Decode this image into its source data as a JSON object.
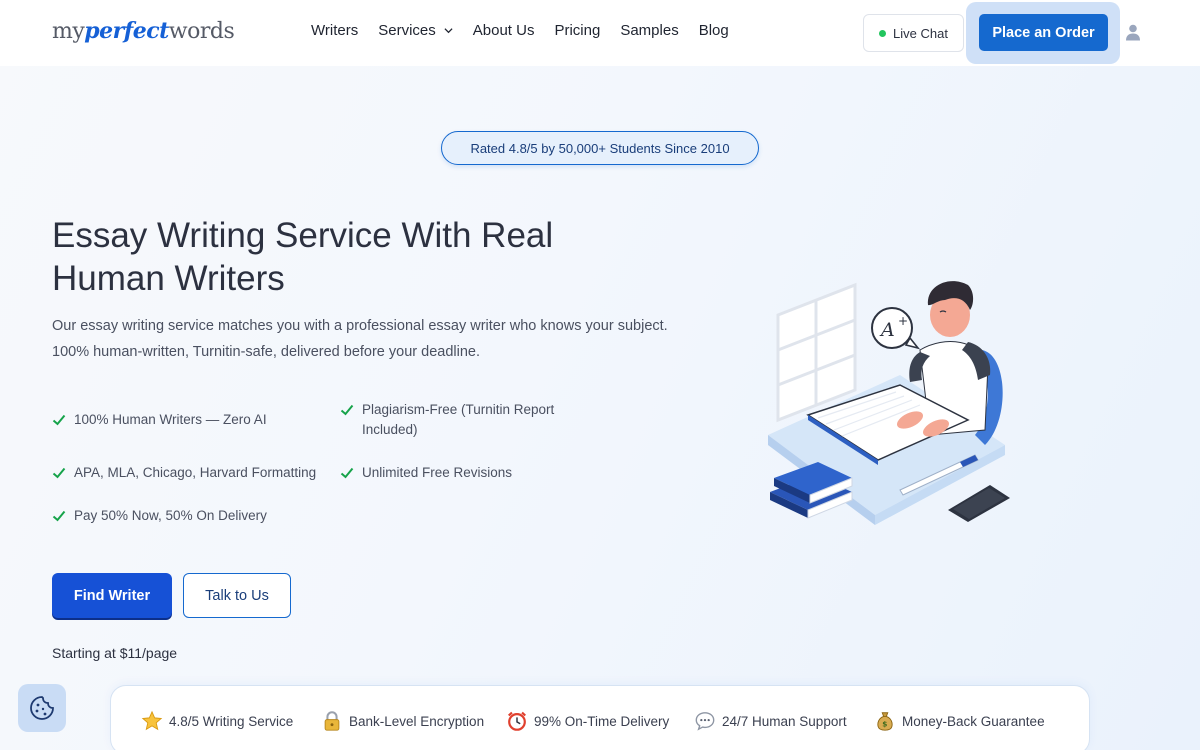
{
  "header": {
    "logo": {
      "part1": "my",
      "part2": "perfect",
      "part3": "words"
    },
    "nav": [
      {
        "label": "Writers"
      },
      {
        "label": "Services"
      },
      {
        "label": "About Us"
      },
      {
        "label": "Pricing"
      },
      {
        "label": "Samples"
      },
      {
        "label": "Blog"
      }
    ],
    "live_chat": "Live Chat",
    "place_order": "Place an Order"
  },
  "hero": {
    "rating_pill": "Rated 4.8/5 by 50,000+ Students Since 2010",
    "title": "Essay Writing Service With Real Human Writers",
    "description": "Our essay writing service matches you with a professional essay writer who knows your subject. 100% human-written, Turnitin-safe, delivered before your deadline.",
    "features": [
      "100% Human Writers — Zero AI",
      "Plagiarism-Free (Turnitin Report Included)",
      "APA, MLA, Chicago, Harvard Formatting",
      "Unlimited Free Revisions",
      "Pay 50% Now, 50% On Delivery"
    ],
    "find_writer": "Find Writer",
    "talk_to_us": "Talk to Us",
    "starting": "Starting at $11/page"
  },
  "trust_bar": [
    {
      "icon": "star-icon",
      "label": "4.8/5 Writing Service"
    },
    {
      "icon": "lock-icon",
      "label": "Bank-Level Encryption"
    },
    {
      "icon": "alarm-clock-icon",
      "label": "99% On-Time Delivery"
    },
    {
      "icon": "speech-bubble-icon",
      "label": "24/7 Human Support"
    },
    {
      "icon": "money-bag-icon",
      "label": "Money-Back Guarantee"
    }
  ],
  "colors": {
    "primary": "#1651d6",
    "accent": "#1569cf",
    "check": "#16a34a",
    "live_dot": "#22c55e"
  }
}
